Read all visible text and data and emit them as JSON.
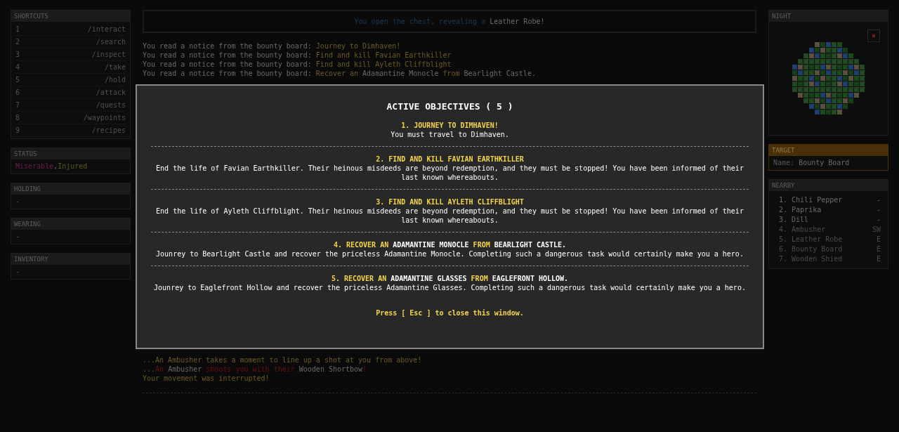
{
  "shortcuts": {
    "title": "SHORTCUTS",
    "items": [
      {
        "key": "1",
        "command": "/interact"
      },
      {
        "key": "2",
        "command": "/search"
      },
      {
        "key": "3",
        "command": "/inspect"
      },
      {
        "key": "4",
        "command": "/take"
      },
      {
        "key": "5",
        "command": "/hold"
      },
      {
        "key": "6",
        "command": "/attack"
      },
      {
        "key": "7",
        "command": "/quests"
      },
      {
        "key": "8",
        "command": "/waypoints"
      },
      {
        "key": "9",
        "command": "/recipes"
      }
    ]
  },
  "status": {
    "title": "STATUS",
    "parts": [
      {
        "text": "Miserable",
        "kind": "bad"
      },
      {
        "text": ",",
        "kind": "plain"
      },
      {
        "text": "Injured",
        "kind": "warn"
      }
    ]
  },
  "holding": {
    "title": "HOLDING",
    "value": "-"
  },
  "wearing": {
    "title": "WEARING",
    "value": "-"
  },
  "inventory": {
    "title": "INVENTORY",
    "value": "-"
  },
  "notice": [
    {
      "text": "You open the chest, revealing a",
      "kind": "info"
    },
    {
      "text": " Leather Robe!",
      "kind": "plain"
    }
  ],
  "log_top": [
    [
      {
        "text": "You read a notice from the bounty board: ",
        "kind": "plain"
      },
      {
        "text": "Journey to Dimhaven!",
        "kind": "quest"
      }
    ],
    [
      {
        "text": "You read a notice from the bounty board: ",
        "kind": "plain"
      },
      {
        "text": "Find and kill Favian Earthkiller",
        "kind": "quest"
      }
    ],
    [
      {
        "text": "You read a notice from the bounty board: ",
        "kind": "plain"
      },
      {
        "text": "Find and kill Ayleth Cliffblight",
        "kind": "quest"
      }
    ],
    [
      {
        "text": "You read a notice from the bounty board: ",
        "kind": "plain"
      },
      {
        "text": "Recover an ",
        "kind": "quest"
      },
      {
        "text": "Adamantine Monocle ",
        "kind": "plain"
      },
      {
        "text": "from ",
        "kind": "quest"
      },
      {
        "text": "Bearlight Castle.",
        "kind": "plain"
      }
    ]
  ],
  "log_bottom": [
    [
      {
        "text": "...",
        "kind": "quest"
      },
      {
        "text": "An Ambusher takes a moment to line up a shot at you from above!",
        "kind": "quest"
      }
    ],
    [
      {
        "text": "...",
        "kind": "quest"
      },
      {
        "text": "An",
        "kind": "danger"
      },
      {
        "text": " Ambusher ",
        "kind": "plain"
      },
      {
        "text": "shoots you with their",
        "kind": "danger"
      },
      {
        "text": " Wooden Shortbow",
        "kind": "plain"
      },
      {
        "text": "!",
        "kind": "danger"
      }
    ],
    [
      {
        "text": "Your movement was interrupted!",
        "kind": "quest"
      }
    ]
  ],
  "map": {
    "title": "NIGHT"
  },
  "target": {
    "title": "TARGET",
    "label": "Name:",
    "value": "Bounty Board"
  },
  "nearby": {
    "title": "NEARBY",
    "items": [
      {
        "index": "1.",
        "name": "Chili Pepper",
        "direction": "-",
        "disabled": false
      },
      {
        "index": "2.",
        "name": "Paprika",
        "direction": "-",
        "disabled": false
      },
      {
        "index": "3.",
        "name": "Dill",
        "direction": "-",
        "disabled": false
      },
      {
        "index": "4.",
        "name": "Ambusher",
        "direction": "SW",
        "disabled": true
      },
      {
        "index": "5.",
        "name": "Leather Robe",
        "direction": "E",
        "disabled": true
      },
      {
        "index": "6.",
        "name": "Bounty Board",
        "direction": "E",
        "disabled": true
      },
      {
        "index": "7.",
        "name": "Wooden Shied",
        "direction": "E",
        "disabled": true
      }
    ]
  },
  "modal": {
    "title": "ACTIVE OBJECTIVES ( 5 )",
    "objectives": [
      {
        "title": [
          {
            "text": "1. JOURNEY TO DIMHAVEN!",
            "kind": "quest"
          }
        ],
        "description": "You must travel to Dimhaven."
      },
      {
        "title": [
          {
            "text": "2. FIND AND KILL FAVIAN EARTHKILLER",
            "kind": "quest"
          }
        ],
        "description": "End the life of Favian Earthkiller. Their heinous misdeeds are beyond redemption, and they must be stopped! You have been informed of their last known whereabouts."
      },
      {
        "title": [
          {
            "text": "3. FIND AND KILL AYLETH CLIFFBLIGHT",
            "kind": "quest"
          }
        ],
        "description": "End the life of Ayleth Cliffblight. Their heinous misdeeds are beyond redemption, and they must be stopped! You have been informed of their last known whereabouts."
      },
      {
        "title": [
          {
            "text": "4. RECOVER AN ",
            "kind": "quest"
          },
          {
            "text": "ADAMANTINE MONOCLE ",
            "kind": "plain"
          },
          {
            "text": "FROM ",
            "kind": "quest"
          },
          {
            "text": "BEARLIGHT CASTLE.",
            "kind": "plain"
          }
        ],
        "description": "Jounrey to Bearlight Castle and recover the priceless Adamantine Monocle. Completing such a dangerous task would certainly make you a hero."
      },
      {
        "title": [
          {
            "text": "5. RECOVER AN ",
            "kind": "quest"
          },
          {
            "text": "ADAMANTINE GLASSES ",
            "kind": "plain"
          },
          {
            "text": "FROM ",
            "kind": "quest"
          },
          {
            "text": "EAGLEFRONT HOLLOW.",
            "kind": "plain"
          }
        ],
        "description": "Jounrey to Eaglefront Hollow and recover the priceless Adamantine Glasses. Completing such a dangerous task would certainly make you a hero."
      }
    ],
    "footer": "Press [ Esc ] to close this window."
  }
}
